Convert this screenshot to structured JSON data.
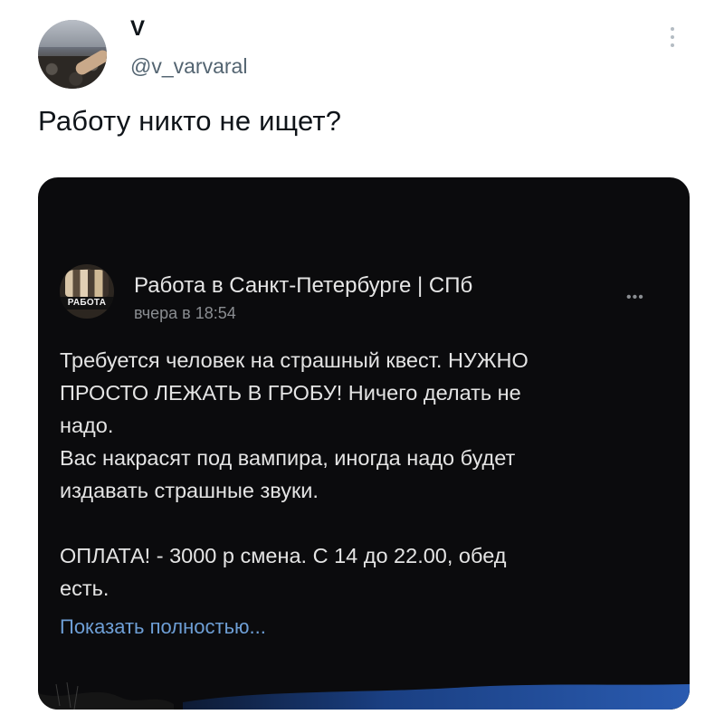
{
  "tweet": {
    "display_name": "V",
    "handle": "@v_varvaral",
    "text": "Работу никто не ищет?"
  },
  "post": {
    "title": "Работа в Санкт-Петербурге | СПб",
    "time": "вчера в 18:54",
    "avatar_badge": "РАБОТА",
    "more_icon": "…",
    "lines": [
      "Требуется человек на страшный квест. НУЖНО",
      "ПРОСТО ЛЕЖАТЬ В ГРОБУ! Ничего делать не",
      "надо.",
      "Вас накрасят под вампира, иногда надо будет",
      "издавать страшные звуки.",
      "",
      "ОПЛАТА! - 3000 р смена. С 14 до 22.00, обед",
      "есть."
    ],
    "show_more": "Показать полностью..."
  },
  "icons": {
    "avatar": "user-avatar-icon",
    "more": "more-vertical-icon",
    "post_more": "more-horizontal-icon"
  },
  "colors": {
    "link": "#6e9fd6",
    "card_bg": "#0b0b0d",
    "text_dark": "#0f1419",
    "text_muted": "#536471"
  }
}
